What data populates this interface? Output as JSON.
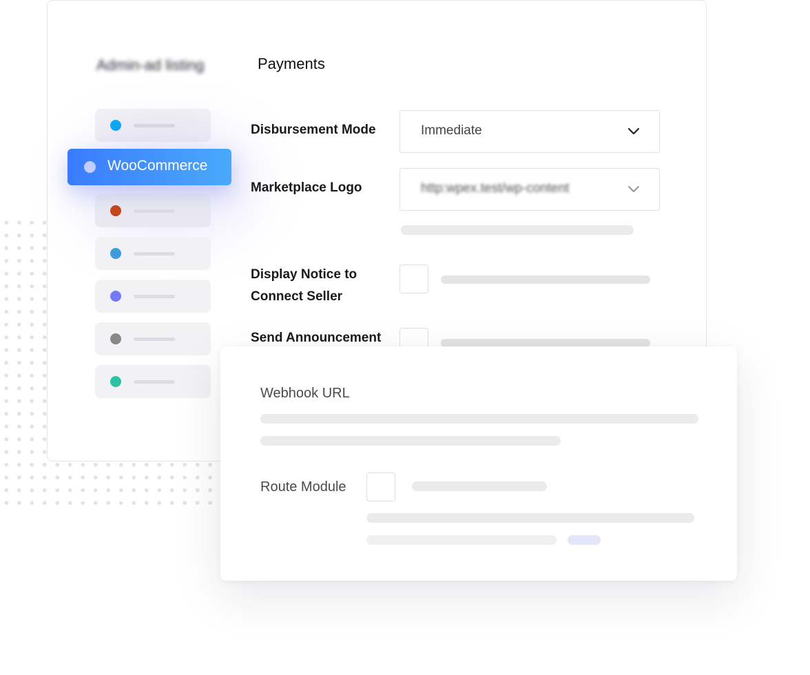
{
  "sidebar": {
    "title": "Admin-ad listing",
    "items": [
      {
        "color": "#0aa9f6"
      },
      {
        "label": "WooCommerce",
        "active": true
      },
      {
        "color": "#c4461a"
      },
      {
        "color": "#3e9bdb"
      },
      {
        "color": "#7579f7"
      },
      {
        "color": "#888888"
      },
      {
        "color": "#2bc3a1"
      }
    ]
  },
  "main": {
    "title": "Payments",
    "fields": {
      "disbursement_mode": {
        "label": "Disbursement Mode",
        "value": "Immediate"
      },
      "marketplace_logo": {
        "label": "Marketplace Logo",
        "value": "http:wpex.test/wp-content"
      },
      "display_notice": {
        "label_line1": "Display Notice to",
        "label_line2": "Connect Seller"
      },
      "send_announcement": {
        "label": "Send Announcement"
      }
    }
  },
  "overlay": {
    "webhook_url": {
      "label": "Webhook URL"
    },
    "route_module": {
      "label": "Route Module"
    }
  },
  "colors": {
    "accent_gradient_start": "#3a7bff",
    "accent_gradient_end": "#4aa9fb",
    "skeleton": "#ebebed",
    "skeleton_highlight": "#e4e5fb"
  }
}
